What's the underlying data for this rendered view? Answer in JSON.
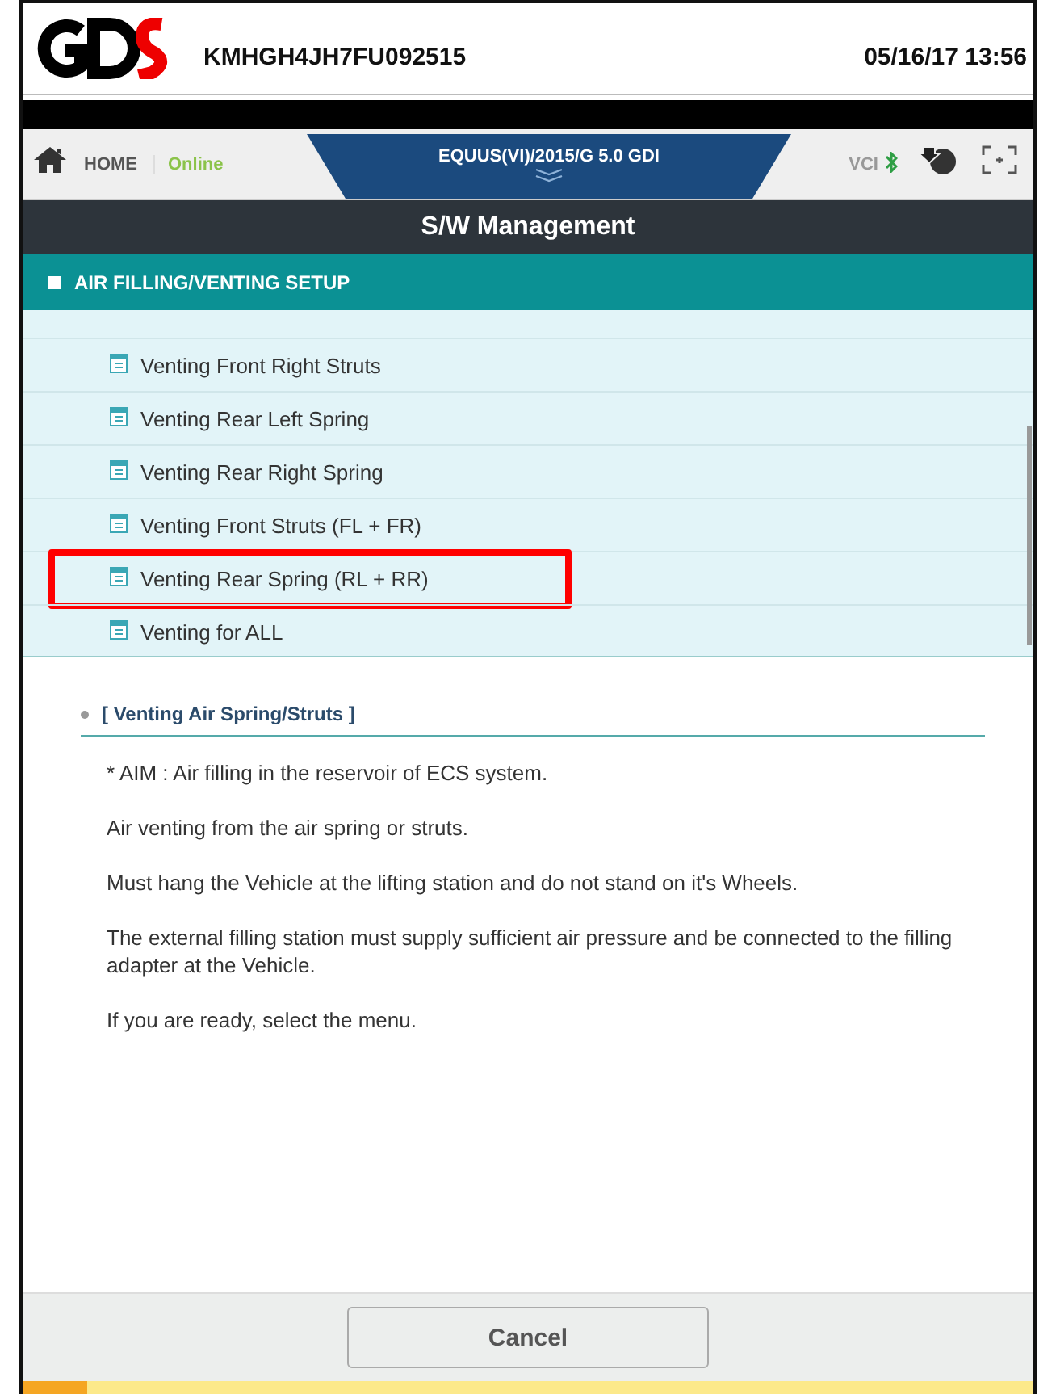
{
  "header": {
    "vin": "KMHGH4JH7FU092515",
    "datetime": "05/16/17 13:56"
  },
  "nav": {
    "home": "HOME",
    "status": "Online",
    "vehicle": "EQUUS(VI)/2015/G 5.0 GDI",
    "vci": "VCI"
  },
  "title": "S/W Management",
  "section": "AIR FILLING/VENTING SETUP",
  "menu_items": [
    {
      "label": "Venting Front Right Struts",
      "highlighted": false
    },
    {
      "label": "Venting Rear Left Spring",
      "highlighted": false
    },
    {
      "label": "Venting Rear Right Spring",
      "highlighted": false
    },
    {
      "label": "Venting Front Struts (FL + FR)",
      "highlighted": false
    },
    {
      "label": "Venting Rear Spring (RL + RR)",
      "highlighted": true
    },
    {
      "label": "Venting for ALL",
      "highlighted": false
    }
  ],
  "info": {
    "heading": "[ Venting Air Spring/Struts ]",
    "paragraphs": [
      "* AIM : Air filling in the reservoir of ECS system.",
      "Air venting from the air spring or struts.",
      "Must hang the Vehicle at the lifting station and do not stand on it's Wheels.",
      "The external filling station must supply sufficient air pressure and be connected to the filling adapter at the Vehicle.",
      "If you are ready, select the menu."
    ]
  },
  "buttons": [
    "Cancel"
  ]
}
